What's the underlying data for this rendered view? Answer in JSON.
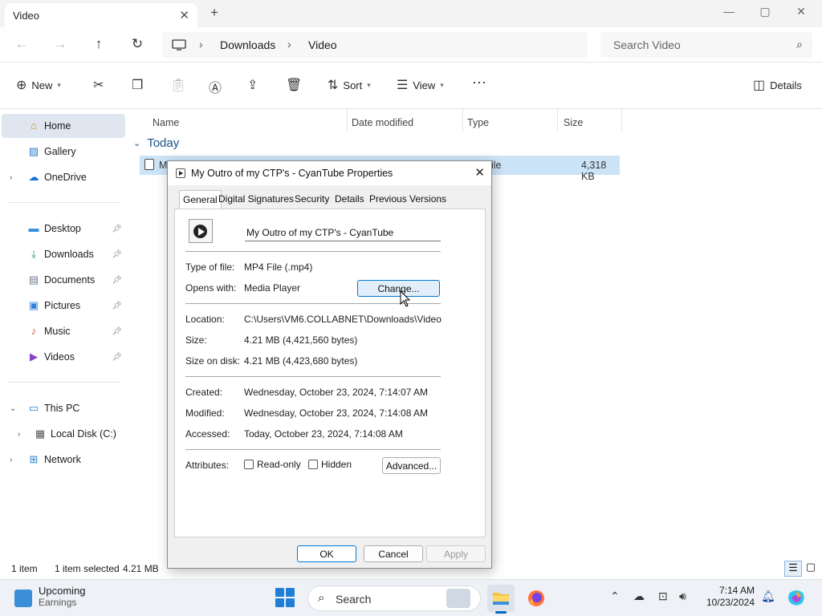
{
  "window": {
    "tab_title": "Video",
    "tab_close": "✕",
    "new_tab": "+",
    "minimize": "—",
    "maximize": "▢",
    "close": "✕"
  },
  "address": {
    "breadcrumb": [
      "Downloads",
      "Video"
    ],
    "separator": "›",
    "search_placeholder": "Search Video"
  },
  "commands": {
    "new": "New",
    "sort": "Sort",
    "view": "View",
    "more": "···",
    "details": "Details"
  },
  "sidebar": {
    "items": [
      {
        "label": "Home",
        "icon": "home-icon"
      },
      {
        "label": "Gallery",
        "icon": "gallery-icon"
      },
      {
        "label": "OneDrive",
        "icon": "cloud-icon"
      },
      {
        "label": "Desktop",
        "icon": "desktop-icon"
      },
      {
        "label": "Downloads",
        "icon": "download-icon"
      },
      {
        "label": "Documents",
        "icon": "document-icon"
      },
      {
        "label": "Pictures",
        "icon": "picture-icon"
      },
      {
        "label": "Music",
        "icon": "music-icon"
      },
      {
        "label": "Videos",
        "icon": "video-icon"
      },
      {
        "label": "This PC",
        "icon": "pc-icon"
      },
      {
        "label": "Local Disk (C:)",
        "icon": "disk-icon"
      },
      {
        "label": "Network",
        "icon": "network-icon"
      }
    ]
  },
  "columns": {
    "name": "Name",
    "date_modified": "Date modified",
    "type": "Type",
    "size": "Size"
  },
  "group": {
    "label": "Today"
  },
  "file": {
    "name_visible": "M",
    "type_visible": "ile",
    "size": "4,318 KB"
  },
  "status": {
    "count": "1 item",
    "selected": "1 item selected",
    "size": "4.21 MB"
  },
  "dialog": {
    "title": "My Outro of my CTP's - CyanTube Properties",
    "tabs": [
      "General",
      "Digital Signatures",
      "Security",
      "Details",
      "Previous Versions"
    ],
    "file_name": "My Outro of my CTP's - CyanTube",
    "type_label": "Type of file:",
    "type_value": "MP4 File (.mp4)",
    "opens_label": "Opens with:",
    "opens_value": "Media Player",
    "change_button": "Change...",
    "location_label": "Location:",
    "location_value": "C:\\Users\\VM6.COLLABNET\\Downloads\\Video",
    "size_label": "Size:",
    "size_value": "4.21 MB (4,421,560 bytes)",
    "size_disk_label": "Size on disk:",
    "size_disk_value": "4.21 MB (4,423,680 bytes)",
    "created_label": "Created:",
    "created_value": "Wednesday, October 23, 2024, 7:14:07 AM",
    "modified_label": "Modified:",
    "modified_value": "Wednesday, October 23, 2024, 7:14:08 AM",
    "accessed_label": "Accessed:",
    "accessed_value": "Today, October 23, 2024, 7:14:08 AM",
    "attributes_label": "Attributes:",
    "readonly_label": "Read-only",
    "hidden_label": "Hidden",
    "advanced_button": "Advanced...",
    "ok": "OK",
    "cancel": "Cancel",
    "apply": "Apply"
  },
  "taskbar": {
    "weather_title": "Upcoming",
    "weather_sub": "Earnings",
    "search": "Search",
    "time": "7:14 AM",
    "date": "10/23/2024"
  }
}
